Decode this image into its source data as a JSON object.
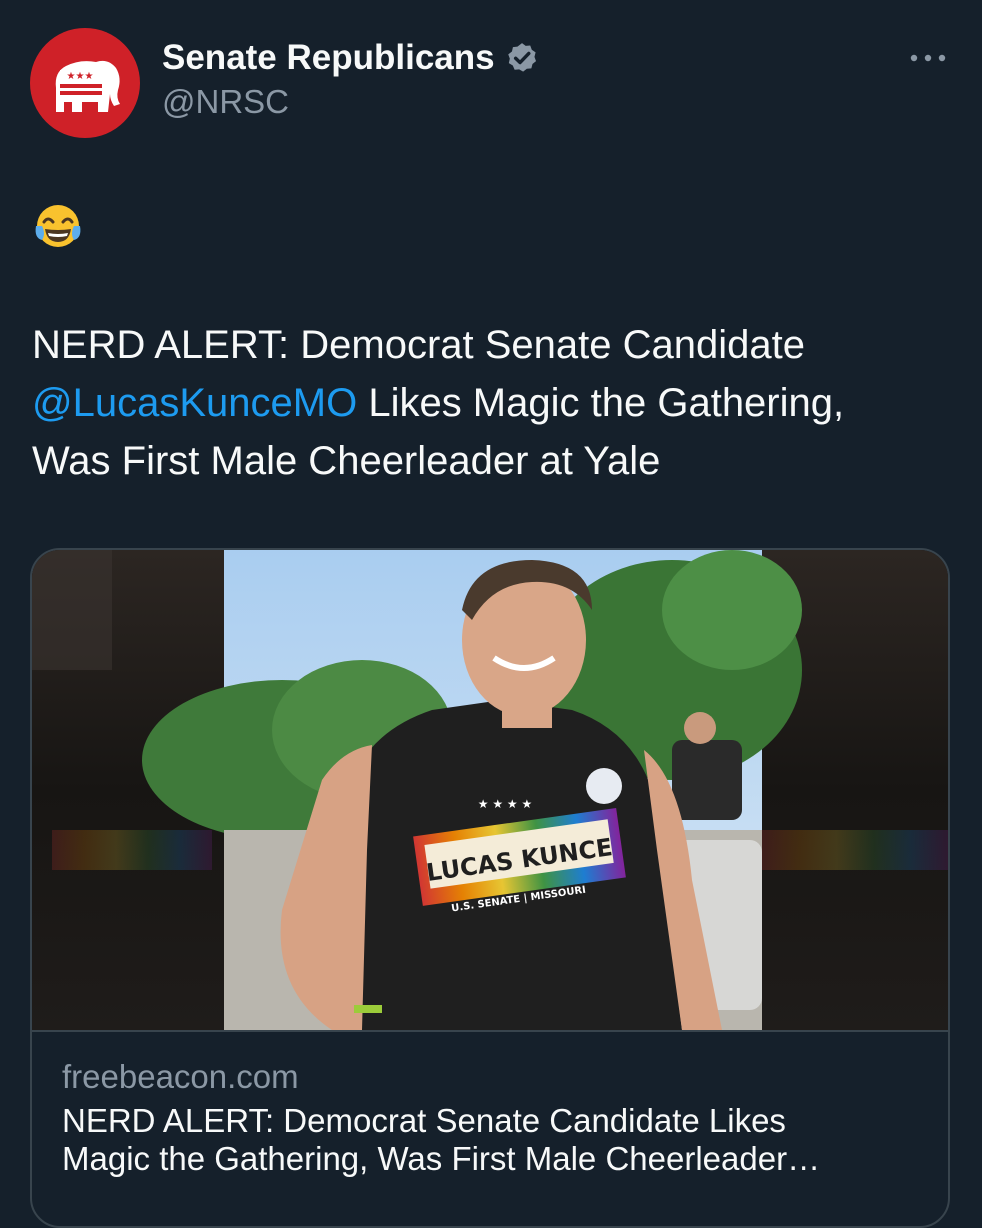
{
  "author": {
    "display_name": "Senate Republicans",
    "handle": "@NRSC",
    "verified": true,
    "avatar_color": "#cf2128",
    "avatar_icon": "elephant-logo-icon"
  },
  "tweet": {
    "emoji": "face-with-tears-of-joy-emoji",
    "text_line1": "NERD ALERT: Democrat Senate Candidate",
    "mention": "@LucasKunceMO",
    "text_line2_rest": " Likes Magic the Gathering,",
    "text_line3": "Was First Male Cheerleader at Yale"
  },
  "link_card": {
    "domain": "freebeacon.com",
    "title_line1": "NERD ALERT: Democrat Senate Candidate Likes",
    "title_line2": "Magic the Gathering, Was First Male Cheerleader…",
    "shirt_text": "LUCAS KUNCE",
    "shirt_subtext": "U.S. SENATE | MISSOURI"
  },
  "colors": {
    "background": "#15202b",
    "text": "#f7f9f9",
    "secondary_text": "#8b98a5",
    "link": "#1d9bf0",
    "border": "#38444d"
  }
}
